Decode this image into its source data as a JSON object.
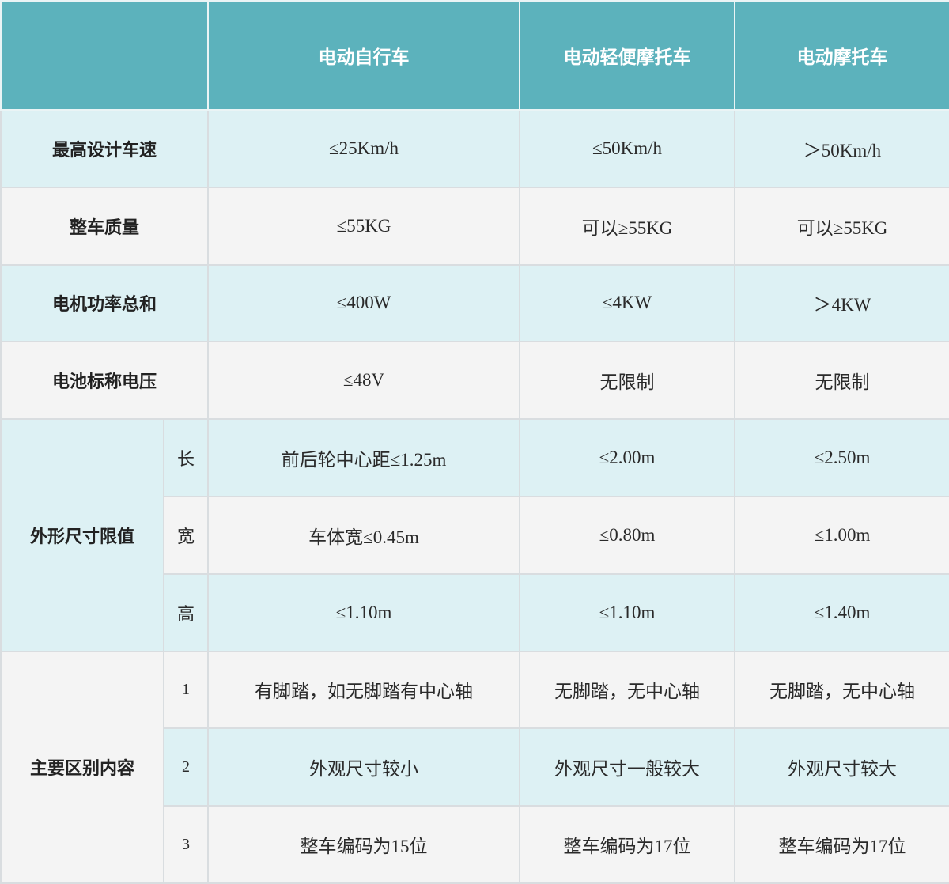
{
  "header": {
    "corner": "",
    "col1": "电动自行车",
    "col2": "电动轻便摩托车",
    "col3": "电动摩托车"
  },
  "rows": {
    "speed": {
      "label": "最高设计车速",
      "v1": "≤25Km/h",
      "v2": "≤50Km/h",
      "v3": "＞50Km/h"
    },
    "mass": {
      "label": "整车质量",
      "v1": "≤55KG",
      "v2": "可以≥55KG",
      "v3": "可以≥55KG"
    },
    "power": {
      "label": "电机功率总和",
      "v1": "≤400W",
      "v2": "≤4KW",
      "v3": "＞4KW"
    },
    "voltage": {
      "label": "电池标称电压",
      "v1": "≤48V",
      "v2": "无限制",
      "v3": "无限制"
    }
  },
  "dims": {
    "label": "外形尺寸限值",
    "length": {
      "sub": "长",
      "v1": "前后轮中心距≤1.25m",
      "v2": "≤2.00m",
      "v3": "≤2.50m"
    },
    "width": {
      "sub": "宽",
      "v1": "车体宽≤0.45m",
      "v2": "≤0.80m",
      "v3": "≤1.00m"
    },
    "height": {
      "sub": "高",
      "v1": "≤1.10m",
      "v2": "≤1.10m",
      "v3": "≤1.40m"
    }
  },
  "diff": {
    "label": "主要区别内容",
    "r1": {
      "sub": "1",
      "v1": "有脚踏，如无脚踏有中心轴",
      "v2": "无脚踏，无中心轴",
      "v3": "无脚踏，无中心轴"
    },
    "r2": {
      "sub": "2",
      "v1": "外观尺寸较小",
      "v2": "外观尺寸一般较大",
      "v3": "外观尺寸较大"
    },
    "r3": {
      "sub": "3",
      "v1": "整车编码为15位",
      "v2": "整车编码为17位",
      "v3": "整车编码为17位"
    }
  }
}
